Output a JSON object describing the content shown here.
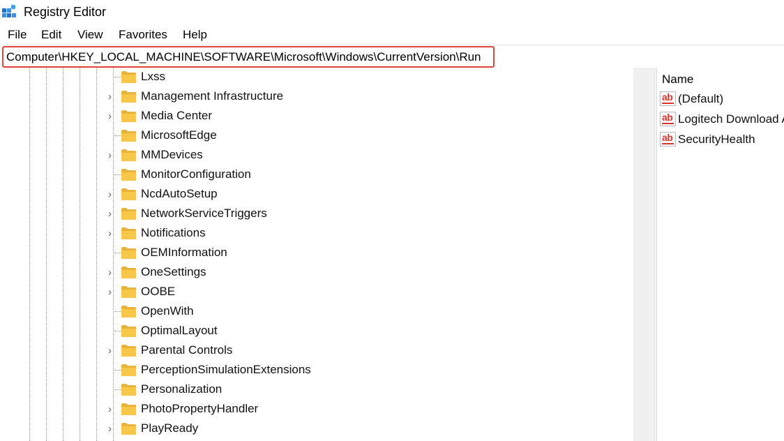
{
  "window": {
    "title": "Registry Editor"
  },
  "menu": {
    "file": "File",
    "edit": "Edit",
    "view": "View",
    "favorites": "Favorites",
    "help": "Help"
  },
  "address": {
    "path": "Computer\\HKEY_LOCAL_MACHINE\\SOFTWARE\\Microsoft\\Windows\\CurrentVersion\\Run"
  },
  "tree": {
    "items": [
      {
        "label": "Lxss",
        "expandable": false
      },
      {
        "label": "Management Infrastructure",
        "expandable": true
      },
      {
        "label": "Media Center",
        "expandable": true
      },
      {
        "label": "MicrosoftEdge",
        "expandable": false
      },
      {
        "label": "MMDevices",
        "expandable": true
      },
      {
        "label": "MonitorConfiguration",
        "expandable": false
      },
      {
        "label": "NcdAutoSetup",
        "expandable": true
      },
      {
        "label": "NetworkServiceTriggers",
        "expandable": true
      },
      {
        "label": "Notifications",
        "expandable": true
      },
      {
        "label": "OEMInformation",
        "expandable": false
      },
      {
        "label": "OneSettings",
        "expandable": true
      },
      {
        "label": "OOBE",
        "expandable": true
      },
      {
        "label": "OpenWith",
        "expandable": false
      },
      {
        "label": "OptimalLayout",
        "expandable": false
      },
      {
        "label": "Parental Controls",
        "expandable": true
      },
      {
        "label": "PerceptionSimulationExtensions",
        "expandable": false
      },
      {
        "label": "Personalization",
        "expandable": false
      },
      {
        "label": "PhotoPropertyHandler",
        "expandable": true
      },
      {
        "label": "PlayReady",
        "expandable": true
      }
    ]
  },
  "values": {
    "column_name": "Name",
    "items": [
      {
        "name": "(Default)",
        "type_icon": "string-value-icon"
      },
      {
        "name": "Logitech Download Assistant",
        "type_icon": "string-value-icon"
      },
      {
        "name": "SecurityHealth",
        "type_icon": "string-value-icon"
      }
    ]
  },
  "colors": {
    "highlight_border": "#e0443e",
    "folder": "#f7c74a",
    "string_icon": "#d8362f"
  }
}
